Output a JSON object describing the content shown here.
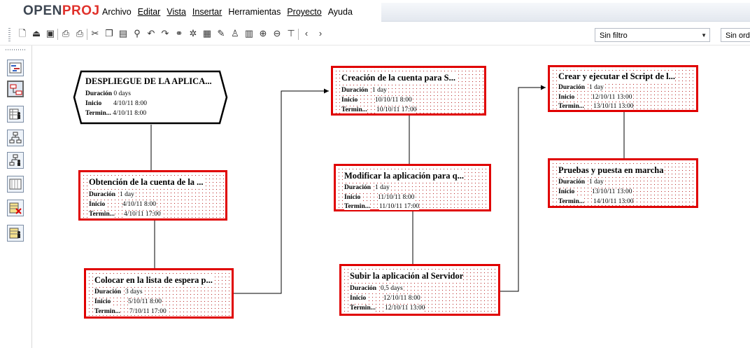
{
  "app": {
    "logo_part1": "OPEN",
    "logo_part2": "PROJ",
    "brand_color": "#e0312b"
  },
  "menu": [
    "Archivo",
    "Editar",
    "Vista",
    "Insertar",
    "Herramientas",
    "Proyecto",
    "Ayuda"
  ],
  "toolbar": {
    "filter_value": "Sin filtro",
    "sort_value": "Sin ord"
  },
  "labels": {
    "duration": "Duración",
    "start": "Inicio",
    "end": "Termin..."
  },
  "tasks": [
    {
      "title": "DESPLIEGUE DE LA APLICA...",
      "duration": "0 days",
      "start": "4/10/11 8:00",
      "end": "4/10/11 8:00"
    },
    {
      "title": "Obtención de la cuenta de la ...",
      "duration": "1 day",
      "start": "4/10/11 8:00",
      "end": "4/10/11 17:00"
    },
    {
      "title": "Colocar en la lista de espera p...",
      "duration": "3 days",
      "start": "5/10/11 8:00",
      "end": "7/10/11 17:00"
    },
    {
      "title": "Creación de la cuenta para S...",
      "duration": "1 day",
      "start": "10/10/11 8:00",
      "end": "10/10/11 17:00"
    },
    {
      "title": "Modificar la aplicación para q...",
      "duration": "1 day",
      "start": "11/10/11 8:00",
      "end": "11/10/11 17:00"
    },
    {
      "title": "Subir la aplicación al Servidor",
      "duration": "0,5 days",
      "start": "12/10/11 8:00",
      "end": "12/10/11 13:00"
    },
    {
      "title": "Crear y ejecutar el Script de l...",
      "duration": "1 day",
      "start": "12/10/11 13:00",
      "end": "13/10/11 13:00"
    },
    {
      "title": "Pruebas y puesta en marcha",
      "duration": "1 day",
      "start": "13/10/11 13:00",
      "end": "14/10/11 13:00"
    }
  ]
}
